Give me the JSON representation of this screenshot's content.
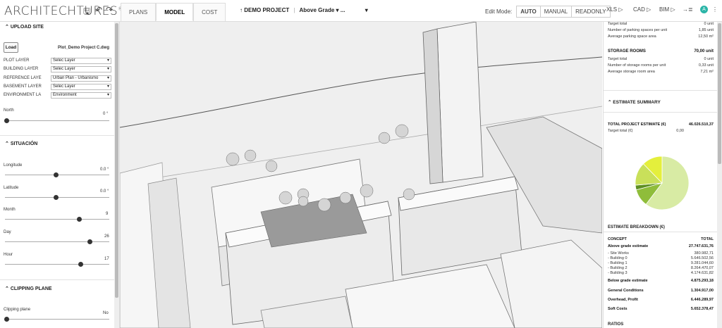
{
  "app": {
    "logo": "ARCHITECHTURES",
    "logo_mark": "®"
  },
  "toolbar": {
    "save_icon": "floppy-icon",
    "undo_icon": "undo-icon",
    "redo_icon": "redo-icon"
  },
  "tabs": [
    {
      "label": "PLANS"
    },
    {
      "label": "MODEL"
    },
    {
      "label": "COST"
    }
  ],
  "project": {
    "name": "DEMO PROJECT",
    "separator": "|",
    "level": "Above Grade",
    "level_dropdown": "▾",
    "more": "...",
    "extra_dropdown": "▾"
  },
  "edit_mode": {
    "label": "Edit Mode:",
    "options": [
      "AUTO",
      "MANUAL",
      "READONLY"
    ],
    "selected": "AUTO"
  },
  "exports": [
    {
      "label": "XLS ▷"
    },
    {
      "label": "CAD ▷"
    },
    {
      "label": "BIM ▷"
    },
    {
      "label": "→≣"
    }
  ],
  "avatar": {
    "initial": "A"
  },
  "menu_dots": "⋮",
  "sidebar": {
    "upload": {
      "title": "UPLOAD SITE",
      "load_label": "Load",
      "file_name": "Plot_Demo Project C.dwg",
      "layers": [
        {
          "label": "PLOT LAYER",
          "value": "Selec Layer"
        },
        {
          "label": "BUILDING LAYER",
          "value": "Selec Layer"
        },
        {
          "label": "REFERENCE LAYE",
          "value": "Urban Plan - Urbanismo"
        },
        {
          "label": "BASEMENT LAYER",
          "value": "Selec Layer"
        },
        {
          "label": "ENVIRONMENT LA",
          "value": "Environment"
        }
      ],
      "north_label": "North",
      "north_value": "0 °"
    },
    "situacion": {
      "title": "SITUACIÓN",
      "longitude_label": "Longitude",
      "longitude_value": "0.0 °",
      "latitude_label": "Latitude",
      "latitude_value": "0.0 °",
      "month_label": "Month",
      "month_value": "9",
      "day_label": "Day",
      "day_value": "26",
      "hour_label": "Hour",
      "hour_value": "17"
    },
    "clipping": {
      "title": "CLIPPING PLANE",
      "label": "Clipping plane",
      "value": "No"
    }
  },
  "right_panel": {
    "parking": [
      {
        "label": "Target total",
        "value": "0 unit"
      },
      {
        "label": "Number of parking spaces per unit",
        "value": "1,85 unit"
      },
      {
        "label": "Average parking space area",
        "value": "12,50 m²"
      }
    ],
    "storage": {
      "title": "STORAGE ROOMS",
      "title_value": "70,00 unit",
      "rows": [
        {
          "label": "Target total",
          "value": "0 unit"
        },
        {
          "label": "Number of storage rooms per unit",
          "value": "0,33 unit"
        },
        {
          "label": "Average storage room area",
          "value": "7,21 m²"
        }
      ]
    },
    "estimate_summary": {
      "title": "ESTIMATE SUMMARY",
      "total_label": "TOTAL PROJECT ESTIMATE (€)",
      "total_value": "46.026.510,37",
      "target_label": "Target total (€)",
      "target_value": "0,00"
    },
    "breakdown": {
      "title": "ESTIMATE BREAKDOWN (€)",
      "col_concept": "CONCEPT",
      "col_total": "TOTAL",
      "rows": [
        {
          "label": "Above grade estimate",
          "value": "27.747.631,76",
          "bold": true
        },
        {
          "label": "- Site Works",
          "value": "380.982,71",
          "bold": false
        },
        {
          "label": "- Building 0",
          "value": "5.646.502,56",
          "bold": false
        },
        {
          "label": "- Building 1",
          "value": "9.281.044,60",
          "bold": false
        },
        {
          "label": "- Building 2",
          "value": "8.264.470,07",
          "bold": false
        },
        {
          "label": "- Building 3",
          "value": "4.174.631,82",
          "bold": false
        },
        {
          "label": "Below grade estimate",
          "value": "4.875.293,18",
          "bold": true
        },
        {
          "label": "General Conditions",
          "value": "1.304.917,00",
          "bold": true
        },
        {
          "label": "Overhead, Profit",
          "value": "6.446.289,97",
          "bold": true
        },
        {
          "label": "Soft Costs",
          "value": "5.652.378,47",
          "bold": true
        }
      ]
    },
    "ratios_title": "RATIOS"
  },
  "colors": {
    "pie": [
      "#d8eba4",
      "#8fbd3a",
      "#5e8f22",
      "#c9e05a",
      "#e4ef3c"
    ]
  },
  "chart_data": {
    "type": "pie",
    "categories": [
      "Above grade estimate",
      "Below grade estimate",
      "General Conditions",
      "Overhead, Profit",
      "Soft Costs"
    ],
    "values": [
      27747631.76,
      4875293.18,
      1304917.0,
      6446289.97,
      5652378.47
    ]
  }
}
